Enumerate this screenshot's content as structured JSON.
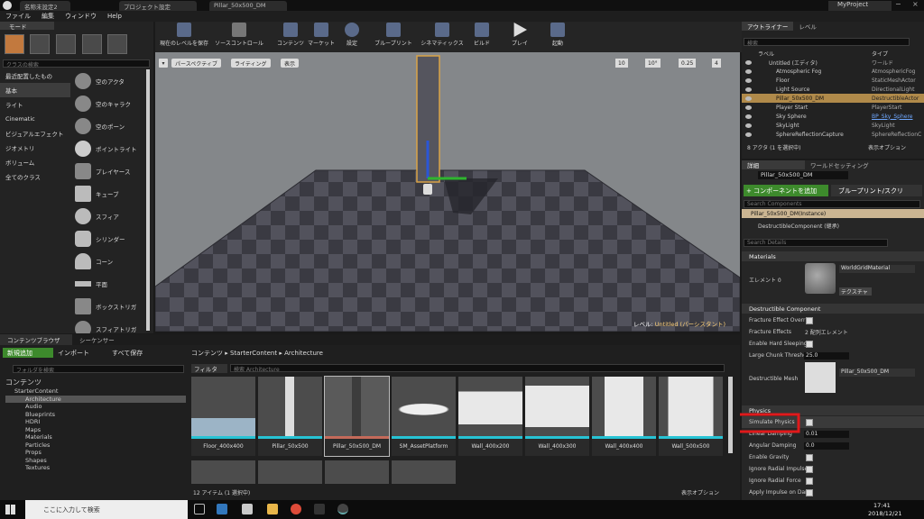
{
  "window": {
    "tabs": [
      "名称未設定2",
      "プロジェクト設定",
      "Pillar_50x500_DM"
    ],
    "project": "MyProject"
  },
  "menu": [
    "ファイル",
    "編集",
    "ウィンドウ",
    "Help"
  ],
  "modes": {
    "title": "モード",
    "search_placeholder": "クラスの検索",
    "categories": [
      "最近配置したもの",
      "基本",
      "ライト",
      "Cinematic",
      "ビジュアルエフェクト",
      "ジオメトリ",
      "ボリューム",
      "全てのクラス"
    ],
    "selected_category": "基本",
    "items": [
      "空のアクタ",
      "空のキャラク",
      "空のポーン",
      "ポイントライト",
      "プレイヤース",
      "キューブ",
      "スフィア",
      "シリンダー",
      "コーン",
      "平面",
      "ボックストリガ",
      "スフィアトリガ"
    ]
  },
  "toolbar": {
    "buttons": [
      "現在のレベルを保存",
      "ソースコントロール",
      "コンテンツ",
      "マーケット",
      "設定",
      "ブループリント",
      "シネマティックス",
      "ビルド",
      "プレイ",
      "起動"
    ]
  },
  "viewport": {
    "perspective": "パースペクティブ",
    "lighting": "ライティング",
    "show": "表示",
    "grid_snap": "10",
    "rot_snap": "10°",
    "scale_snap": "0.25",
    "cam_speed": "4",
    "level_label": "レベル:",
    "level_name": "Untitled (パーシスタント)"
  },
  "outliner": {
    "tab1": "アウトライナー",
    "tab2": "レベル",
    "search_placeholder": "検索",
    "col_label": "ラベル",
    "col_type": "タイプ",
    "rows": [
      {
        "name": "Untitled (エディタ)",
        "type": "ワールド"
      },
      {
        "name": "Atmospheric Fog",
        "type": "AtmosphericFog"
      },
      {
        "name": "Floor",
        "type": "StaticMeshActor"
      },
      {
        "name": "Light Source",
        "type": "DirectionalLight"
      },
      {
        "name": "Pillar_50x500_DM",
        "type": "DestructibleActor"
      },
      {
        "name": "Player Start",
        "type": "PlayerStart"
      },
      {
        "name": "Sky Sphere",
        "type": "BP_Sky_Sphere"
      },
      {
        "name": "SkyLight",
        "type": "SkyLight"
      },
      {
        "name": "SphereReflectionCapture",
        "type": "SphereReflectionC"
      }
    ],
    "status": "8 アクタ (1 を選択中)",
    "view_options": "表示オプション"
  },
  "details": {
    "tab1": "詳細",
    "tab2": "ワールドセッティング",
    "actor_name": "Pillar_50x500_DM",
    "add_component": "+ コンポーネントを追加",
    "blueprint_button": "ブループリント/スクリ",
    "search_components": "Search Components",
    "instance": "Pillar_50x500_DM(Instance)",
    "component": "DestructibleComponent (継承)",
    "search_details": "Search Details",
    "materials_header": "Materials",
    "element0_label": "エレメント 0",
    "material_name": "WorldGridMaterial",
    "textures": "テクスチャ",
    "destructible_header": "Destructible Component",
    "fracture_override": "Fracture Effect Overri",
    "fracture_effects": "Fracture Effects",
    "fracture_effects_value": "2 配列エレメント",
    "enable_hard_sleeping": "Enable Hard Sleeping",
    "large_chunk": "Large Chunk Threshol",
    "large_chunk_value": "25.0",
    "destructible_mesh": "Destructible Mesh",
    "mesh_name": "Pillar_50x500_DM",
    "physics_header": "Physics",
    "physics_rows": [
      {
        "label": "Simulate Physics",
        "value": ""
      },
      {
        "label": "Linear Damping",
        "value": "0.01"
      },
      {
        "label": "Angular Damping",
        "value": "0.0"
      },
      {
        "label": "Enable Gravity",
        "value": ""
      },
      {
        "label": "Ignore Radial Impulse",
        "value": ""
      },
      {
        "label": "Ignore Radial Force",
        "value": ""
      },
      {
        "label": "Apply Impulse on Dam",
        "value": ""
      }
    ]
  },
  "content_browser": {
    "tab1": "コンテンツブラウザ",
    "tab2": "シーケンサー",
    "add_new": "新規追加",
    "import": "インポート",
    "save_all": "すべて保存",
    "breadcrumb": [
      "コンテンツ",
      "StarterContent",
      "Architecture"
    ],
    "folder_search": "フォルダを検索",
    "filter": "フィルタ",
    "asset_search": "検索 Architecture",
    "tree": [
      "コンテンツ",
      "StarterContent",
      "Architecture",
      "Audio",
      "Blueprints",
      "HDRI",
      "Maps",
      "Materials",
      "Particles",
      "Props",
      "Shapes",
      "Textures"
    ],
    "assets": [
      "Floor_400x400",
      "Pillar_50x500",
      "Pillar_50x500_DM",
      "SM_AssetPlatform",
      "Wall_400x200",
      "Wall_400x300",
      "Wall_400x400",
      "Wall_500x500"
    ],
    "status": "12 アイテム (1 選択中)",
    "view_options": "表示オプション"
  },
  "taskbar": {
    "search": "ここに入力して検索",
    "time": "17:41",
    "date": "2018/12/21"
  },
  "colors": {
    "accent_green": "#3d8a2c",
    "selection": "#b08a4a",
    "annotation_red": "#e0191b"
  }
}
